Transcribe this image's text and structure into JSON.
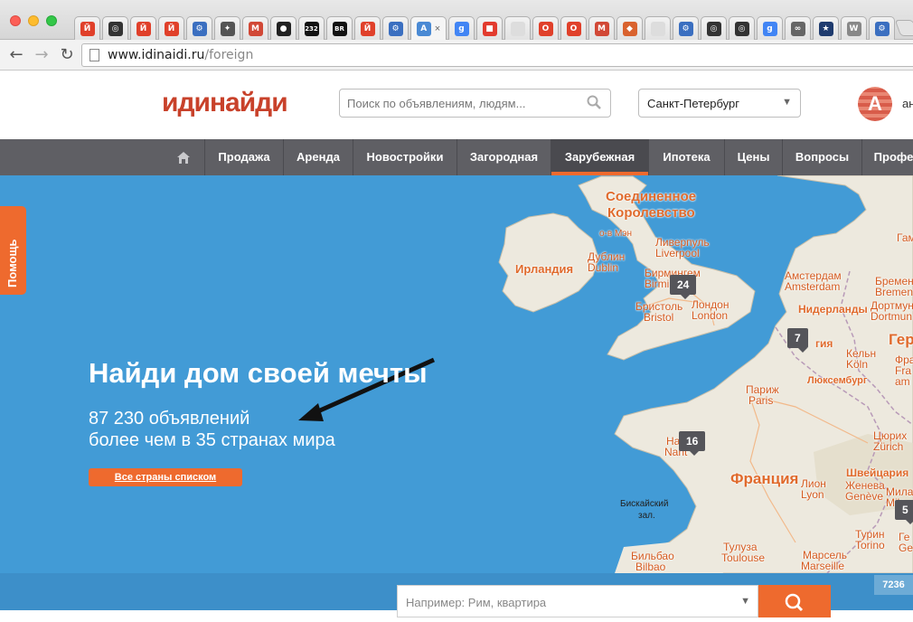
{
  "browser": {
    "tabs": [
      {
        "icon": "yandex-icon",
        "color": "#e0402a",
        "glyph": "Й"
      },
      {
        "icon": "blog-icon",
        "color": "#333333",
        "glyph": "◎"
      },
      {
        "icon": "yandex-icon",
        "color": "#e0402a",
        "glyph": "Й"
      },
      {
        "icon": "yandex-icon",
        "color": "#e0402a",
        "glyph": "Й"
      },
      {
        "icon": "gear-icon",
        "color": "#3b6fc0",
        "glyph": "⚙"
      },
      {
        "icon": "bird-icon",
        "color": "#555555",
        "glyph": "✦"
      },
      {
        "icon": "gmail-icon",
        "color": "#d14836",
        "glyph": "M"
      },
      {
        "icon": "github-icon",
        "color": "#222222",
        "glyph": "●"
      },
      {
        "icon": "232-icon",
        "color": "#111111",
        "glyph": "232"
      },
      {
        "icon": "br-icon",
        "color": "#111111",
        "glyph": "BR"
      },
      {
        "icon": "yandex-icon",
        "color": "#e0402a",
        "glyph": "Й"
      },
      {
        "icon": "gear-icon",
        "color": "#3b6fc0",
        "glyph": "⚙"
      },
      {
        "icon": "translate-icon",
        "color": "#4a8ad4",
        "glyph": "A"
      },
      {
        "icon": "google-icon",
        "color": "#4285f4",
        "glyph": "g"
      },
      {
        "icon": "tag-icon",
        "color": "#e23b2e",
        "glyph": "■"
      },
      {
        "icon": "page-icon",
        "color": "#dddddd",
        "glyph": ""
      },
      {
        "icon": "opera-icon",
        "color": "#e0402a",
        "glyph": "O"
      },
      {
        "icon": "opera-icon",
        "color": "#e0402a",
        "glyph": "O"
      },
      {
        "icon": "gmail-icon",
        "color": "#d14836",
        "glyph": "M"
      },
      {
        "icon": "egg-icon",
        "color": "#d9622e",
        "glyph": "◆"
      },
      {
        "icon": "page-icon",
        "color": "#dddddd",
        "glyph": ""
      },
      {
        "icon": "gear-icon",
        "color": "#3b6fc0",
        "glyph": "⚙"
      },
      {
        "icon": "blog-icon",
        "color": "#333333",
        "glyph": "◎"
      },
      {
        "icon": "blog-icon",
        "color": "#333333",
        "glyph": "◎"
      },
      {
        "icon": "google-icon",
        "color": "#4285f4",
        "glyph": "g"
      },
      {
        "icon": "link-icon",
        "color": "#666666",
        "glyph": "∞"
      },
      {
        "icon": "star-icon",
        "color": "#1f3b6e",
        "glyph": "★"
      },
      {
        "icon": "wikipedia-icon",
        "color": "#888888",
        "glyph": "W"
      },
      {
        "icon": "gear-icon",
        "color": "#3b6fc0",
        "glyph": "⚙"
      }
    ],
    "url_host": "www.idinaidi.ru",
    "url_path": "/foreign"
  },
  "header": {
    "logo_a": "иди",
    "logo_b": "найди",
    "search_placeholder": "Поиск по объявлениям, людям...",
    "city": "Санкт-Петербург",
    "avatar_letter": "A",
    "user_text": "ан"
  },
  "nav": {
    "items": [
      "Продажа",
      "Аренда",
      "Новостройки",
      "Загородная",
      "Зарубежная",
      "Ипотека",
      "Цены",
      "Вопросы",
      "Профе"
    ],
    "active": "Зарубежная"
  },
  "help_label": "Помощь",
  "hero": {
    "title": "Найди дом своей мечты",
    "count_line": "87 230 объявлений",
    "countries_line": "более чем в 35 странах мира",
    "button": "Все страны списком"
  },
  "map": {
    "labels": {
      "uk": "Соединенное",
      "uk2": "Королевство",
      "isle_of_man": "о-в Мэн",
      "liverpool": "Ливерпуль",
      "liverpool_en": "Liverpool",
      "dublin": "Дублин",
      "dublin_en": "Dublin",
      "ireland": "Ирландия",
      "birmingham": "Бирмингем",
      "birmingham_en": "Birmi",
      "bristol": "Бристоль",
      "bristol_en": "Bristol",
      "london": "Лондон",
      "london_en": "London",
      "amsterdam": "Амстердам",
      "amsterdam_en": "Amsterdam",
      "netherlands": "Нидерланды",
      "bremen": "Бремен",
      "bremen_en": "Bremen",
      "dortmund": "Дортмунд",
      "dortmund_en": "Dortmun",
      "belgium_part": "гия",
      "ger_part": "Гер",
      "ham_part": "Гам",
      "cologne": "Кельн",
      "cologne_en": "Köln",
      "luxembourg": "Люксембург",
      "fra_part": "Фра",
      "fra_part2": "Fra",
      "am_part": "am",
      "paris": "Париж",
      "paris_en": "Paris",
      "nantes_part": "Nant",
      "nantes_part2": "Нант",
      "france": "Франция",
      "zurich": "Цюрих",
      "zurich_en": "Zürich",
      "switzerland": "Швейцария",
      "geneva": "Женева",
      "geneva_en": "Genève",
      "lyon": "Лион",
      "lyon_en": "Lyon",
      "milan": "Мила",
      "milan_en": "Mila",
      "biscay": "Бискайский",
      "biscay2": "зал.",
      "turin": "Турин",
      "turin_en": "Torino",
      "genoa_part": "Ге",
      "genoa_part2": "Ge",
      "toulouse": "Тулуза",
      "toulouse_en": "Toulouse",
      "bilbao": "Бильбао",
      "bilbao_en": "Bilbao",
      "marseille": "Марсель",
      "marseille_en": "Marseille"
    },
    "markers": {
      "uk": "24",
      "benelux": "7",
      "france": "16",
      "italy": "5"
    }
  },
  "bottom": {
    "search_placeholder": "Например: Рим, квартира",
    "counter": "7236"
  }
}
